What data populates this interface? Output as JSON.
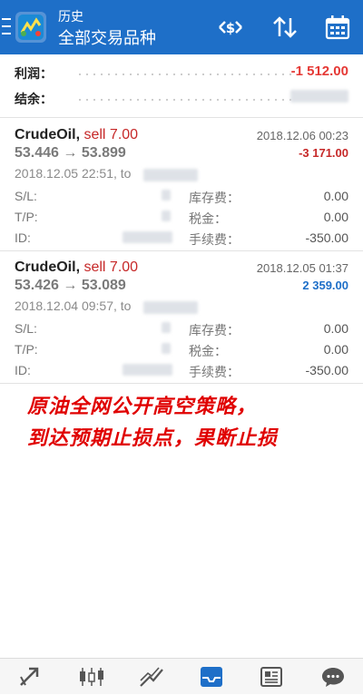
{
  "header": {
    "subtitle": "历史",
    "title": "全部交易品种",
    "bg_color": "#1e6fc8"
  },
  "summary": {
    "profit_label": "利润：",
    "profit_value": "-1 512.00",
    "balance_label": "结余："
  },
  "trades": [
    {
      "symbol": "CrudeOil,",
      "type": "sell 7.00",
      "close_date": "2018.12.06 00:23",
      "prices": "53.446 → 53.899",
      "profit": "-3 171.00",
      "profit_color": "#c62828",
      "open_time": "2018.12.05 22:51, to",
      "sl_label": "S/L:",
      "tp_label": "T/P:",
      "id_label": "ID:",
      "swap_label": "库存费：",
      "swap_value": "0.00",
      "tax_label": "税金：",
      "tax_value": "0.00",
      "fee_label": "手续费：",
      "fee_value": "-350.00"
    },
    {
      "symbol": "CrudeOil,",
      "type": "sell 7.00",
      "close_date": "2018.12.05 01:37",
      "prices": "53.426 → 53.089",
      "profit": "2 359.00",
      "profit_color": "#1e6fc8",
      "open_time": "2018.12.04 09:57, to",
      "sl_label": "S/L:",
      "tp_label": "T/P:",
      "id_label": "ID:",
      "swap_label": "库存费：",
      "swap_value": "0.00",
      "tax_label": "税金：",
      "tax_value": "0.00",
      "fee_label": "手续费：",
      "fee_value": "-350.00"
    }
  ],
  "overlay": {
    "line1": "原油全网公开高空策略，",
    "line2": "到达预期止损点，果断止损"
  },
  "bottom_nav": [
    "trade-icon",
    "chart-candles-icon",
    "chart-lines-icon",
    "history-inbox-icon",
    "news-icon",
    "chat-icon"
  ]
}
